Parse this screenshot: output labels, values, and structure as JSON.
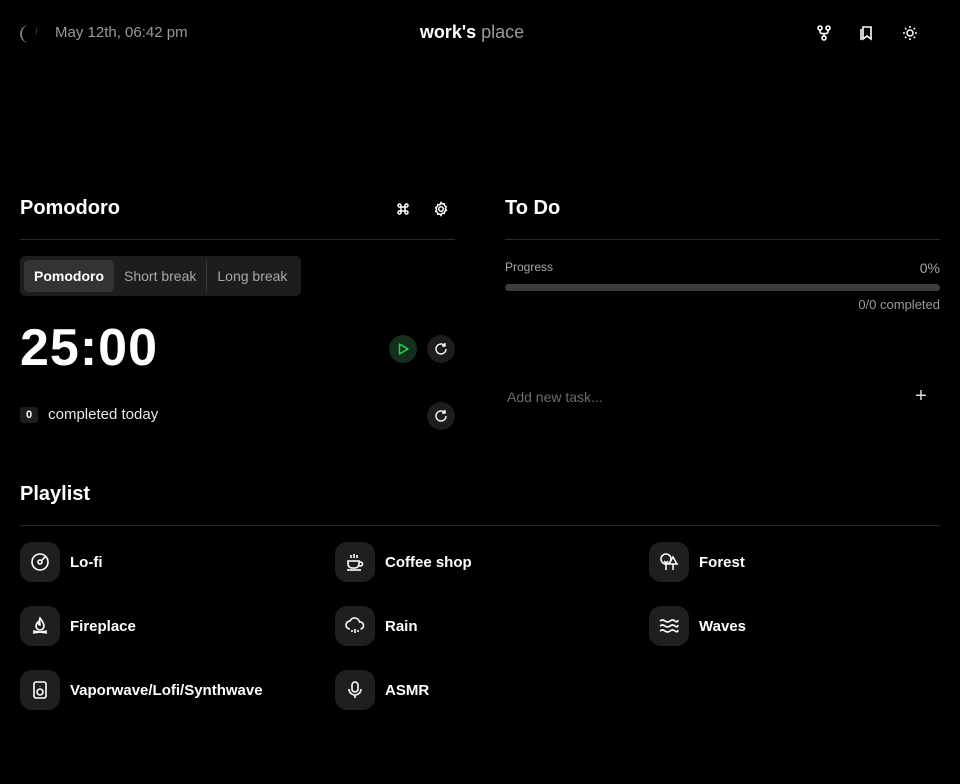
{
  "header": {
    "date": "May 12th, 06:42 pm",
    "title_bold": "work's",
    "title_light": "place",
    "icons": [
      "logo-moon-icon",
      "git-fork-icon",
      "bookmark-icon",
      "sun-icon"
    ]
  },
  "pomodoro": {
    "title": "Pomodoro",
    "tabs": [
      "Pomodoro",
      "Short break",
      "Long break"
    ],
    "active_tab": "Pomodoro",
    "time": "25:00",
    "completed_count": "0",
    "completed_label": "completed today",
    "icons": [
      "command-icon",
      "gear-icon",
      "play-icon",
      "reset-icon"
    ]
  },
  "todo": {
    "title": "To Do",
    "progress_label": "Progress",
    "progress_percent": "0%",
    "progress_value": 0,
    "completed": "0/0 completed",
    "placeholder": "Add new task...",
    "add_label": "+"
  },
  "playlist": {
    "title": "Playlist",
    "items": [
      {
        "name": "Lo-fi",
        "icon": "vinyl-icon"
      },
      {
        "name": "Coffee shop",
        "icon": "coffee-icon"
      },
      {
        "name": "Forest",
        "icon": "trees-icon"
      },
      {
        "name": "Fireplace",
        "icon": "flame-icon"
      },
      {
        "name": "Rain",
        "icon": "cloud-rain-icon"
      },
      {
        "name": "Waves",
        "icon": "waves-icon"
      },
      {
        "name": "Vaporwave/Lofi/Synthwave",
        "icon": "speaker-icon"
      },
      {
        "name": "ASMR",
        "icon": "microphone-icon"
      }
    ]
  },
  "colors": {
    "background": "#000000",
    "card": "#1d1d1f",
    "muted_text": "#9a9a9a",
    "play_accent": "#2fcf5b"
  }
}
